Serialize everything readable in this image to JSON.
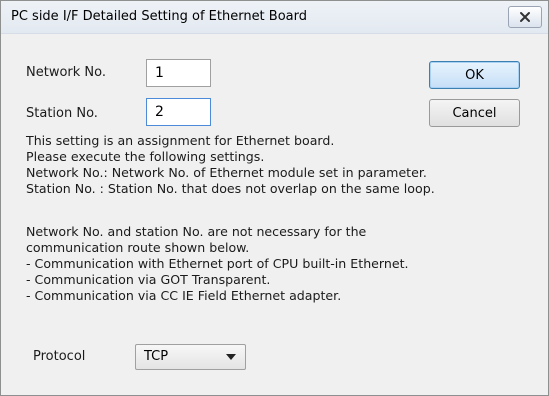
{
  "window": {
    "title": "PC side I/F Detailed Setting of Ethernet Board"
  },
  "form": {
    "network_label": "Network No.",
    "network_value": "1",
    "station_label": "Station No.",
    "station_value": "2",
    "protocol_label": "Protocol",
    "protocol_value": "TCP"
  },
  "buttons": {
    "ok_label": "OK",
    "cancel_label": "Cancel"
  },
  "info": {
    "lines": [
      "This setting is an assignment for Ethernet board.",
      "Please execute the following settings.",
      "Network No.: Network No. of Ethernet module set in parameter.",
      "Station No.  : Station No. that does not overlap on the same loop."
    ],
    "note_lines": [
      "Network No. and station No. are not necessary for the",
      "communication route shown below.",
      "- Communication with Ethernet port of CPU built-in Ethernet.",
      "- Communication via GOT Transparent.",
      "- Communication via CC IE Field Ethernet adapter."
    ]
  },
  "icons": {
    "close": "close-icon",
    "dropdown": "chevron-down-icon"
  },
  "colors": {
    "dialog_bg": "#f0f0f0",
    "default_button_border": "#3c7fb1",
    "focus_border": "#4d8ad7"
  }
}
